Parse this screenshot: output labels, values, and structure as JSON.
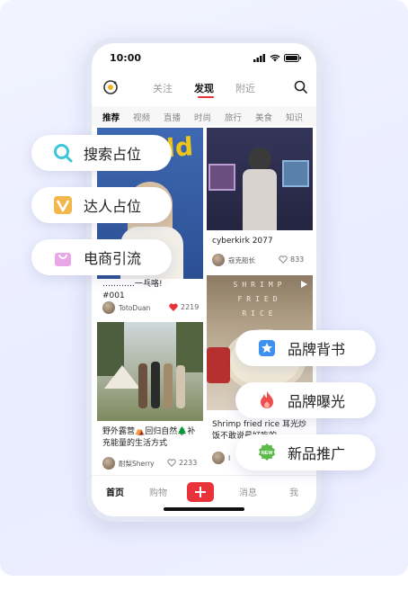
{
  "status": {
    "time": "10:00"
  },
  "topnav": {
    "tabs": [
      "关注",
      "发现",
      "附近"
    ],
    "active": "发现"
  },
  "categories": [
    "推荐",
    "视频",
    "直播",
    "时尚",
    "旅行",
    "美食",
    "知识"
  ],
  "feed": {
    "card1": {
      "title_line1": "…………一乓咯!",
      "title_line2": "#001",
      "author": "TotoDuan",
      "likes": "2219",
      "poster_text": "old"
    },
    "card2": {
      "title": "cyberkirk 2077",
      "author": "寇克船长",
      "likes": "833"
    },
    "card3": {
      "title_line1": "野外露营⛺回归自然🌲补",
      "title_line2": "充能量的生活方式",
      "author": "耐梨Sherry",
      "likes": "2233"
    },
    "card4": {
      "title_line1": "Shrimp fried rice 耳光炒",
      "title_line2": "饭不敢说最好吃的",
      "author": "I",
      "img_text_1": "SHRIMP",
      "img_text_2": "FRIED",
      "img_text_3": "RICE"
    }
  },
  "tabbar": {
    "home": "首页",
    "shop": "购物",
    "messages": "消息",
    "me": "我"
  },
  "pills": {
    "search": "搜索占位",
    "talent": "达人占位",
    "ecommerce": "电商引流",
    "brand_bg": "品牌背书",
    "brand_exposure": "品牌曝光",
    "new_product": "新品推广"
  },
  "badges": {
    "new": "NEW"
  },
  "colors": {
    "accent": "#e8333b",
    "background": "#eef0ff"
  }
}
